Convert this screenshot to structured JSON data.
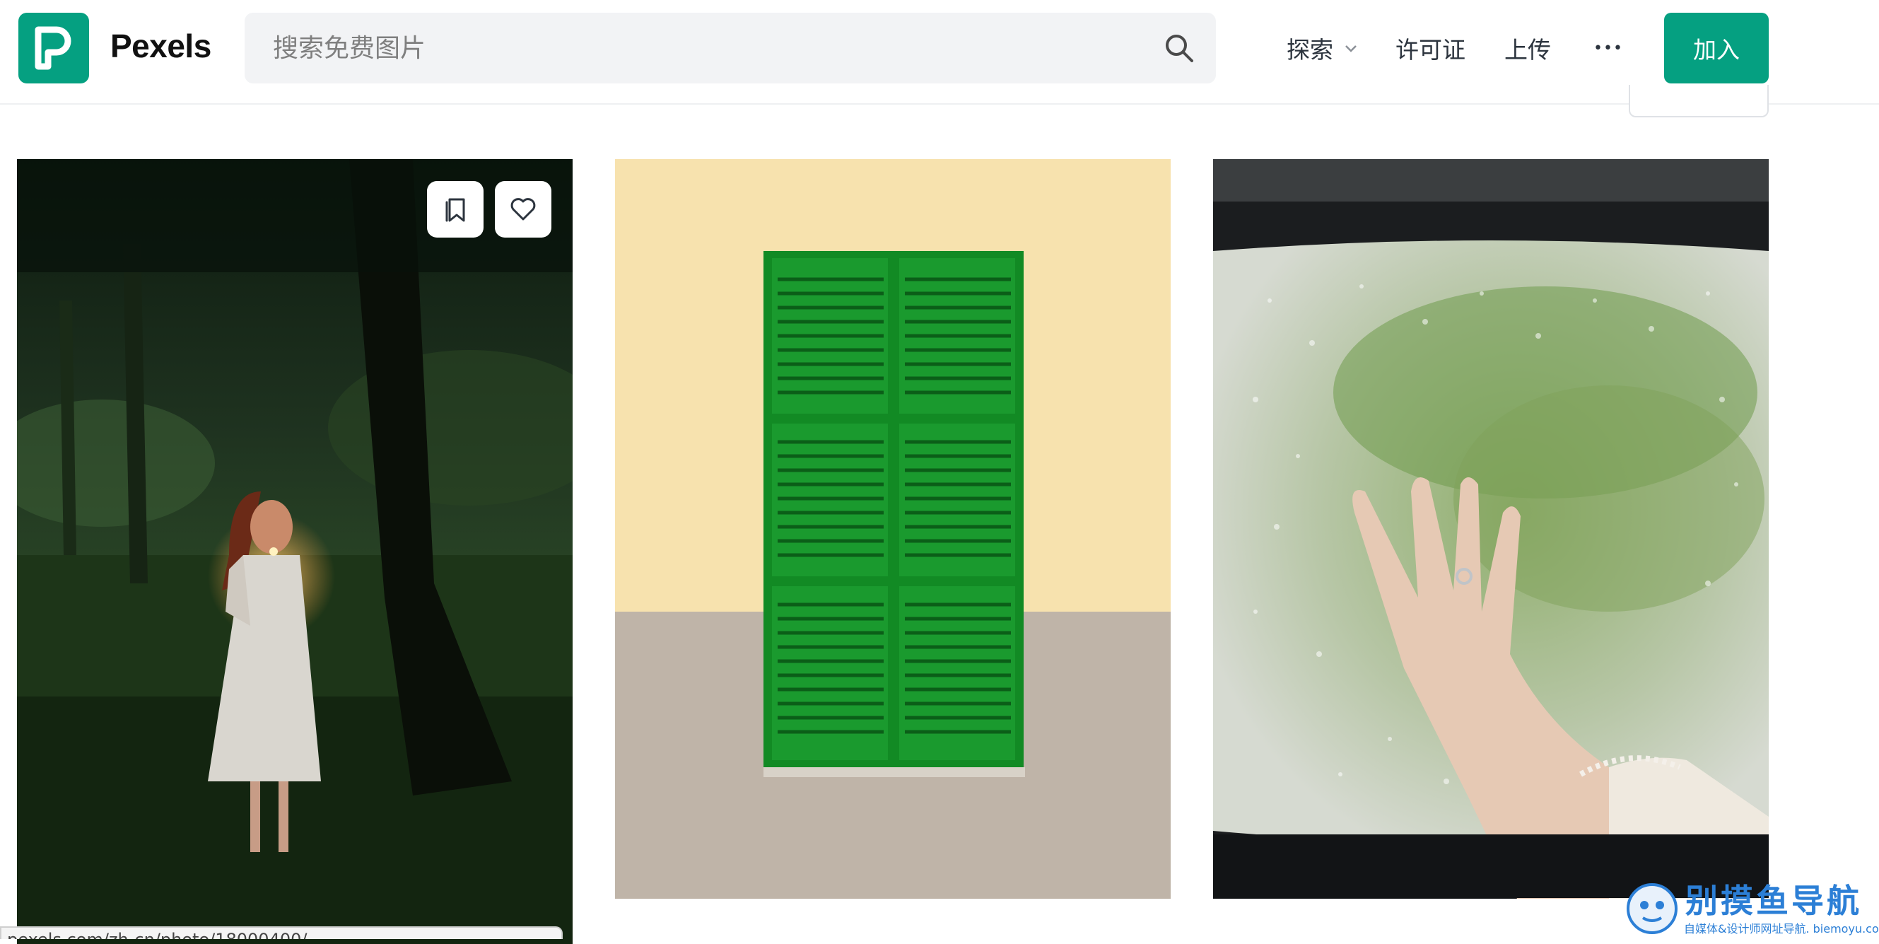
{
  "header": {
    "brand": "Pexels",
    "logo_letter": "P",
    "search": {
      "placeholder": "搜索免费图片",
      "value": ""
    },
    "nav": {
      "explore": "探索",
      "license": "许可证",
      "upload": "上传",
      "more": "•••"
    },
    "join_label": "加入"
  },
  "colors": {
    "brand": "#05a081",
    "search_bg": "#f2f3f5",
    "text": "#2c343e"
  },
  "photos": [
    {
      "subject": "woman-with-candle-in-dark-forest",
      "actions": [
        "bookmark-icon",
        "heart-icon"
      ]
    },
    {
      "subject": "green-window-shutters-on-yellow-wall"
    },
    {
      "subject": "hand-on-rainy-window"
    }
  ],
  "status_bar": {
    "url": "pexels.com/zh-cn/photo/18000400/"
  },
  "watermark": {
    "title": "别摸鱼导航",
    "subtitle": "自媒体&设计师网址导航. biemoyu.com"
  }
}
